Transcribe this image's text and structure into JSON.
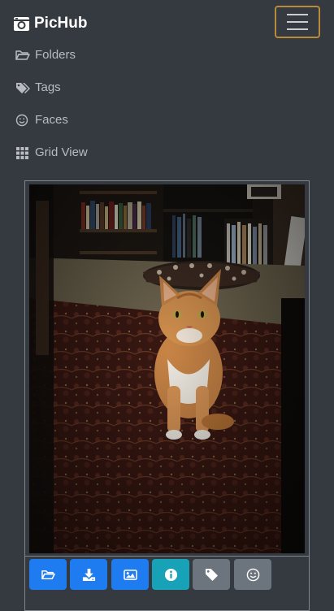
{
  "app": {
    "brand": "PicHub"
  },
  "nav": {
    "folders": "Folders",
    "tags": "Tags",
    "faces": "Faces",
    "grid_view": "Grid View"
  },
  "photo": {
    "subject": "orange and white cat sitting on a patterned rug in front of bookshelves"
  },
  "actions": [
    {
      "icon": "folder-open-icon",
      "color": "#1f7bf0"
    },
    {
      "icon": "download-icon",
      "color": "#1f7bf0"
    },
    {
      "icon": "image-icon",
      "color": "#1f7bf0"
    },
    {
      "icon": "info-icon",
      "color": "#17a2b8"
    },
    {
      "icon": "tag-icon",
      "color": "#6c757d"
    },
    {
      "icon": "smile-icon",
      "color": "#6c757d"
    }
  ],
  "colors": {
    "background": "#343a40",
    "primary": "#1f7bf0",
    "info": "#17a2b8",
    "secondary": "#6c757d",
    "toggler_border": "#b88a3a"
  }
}
